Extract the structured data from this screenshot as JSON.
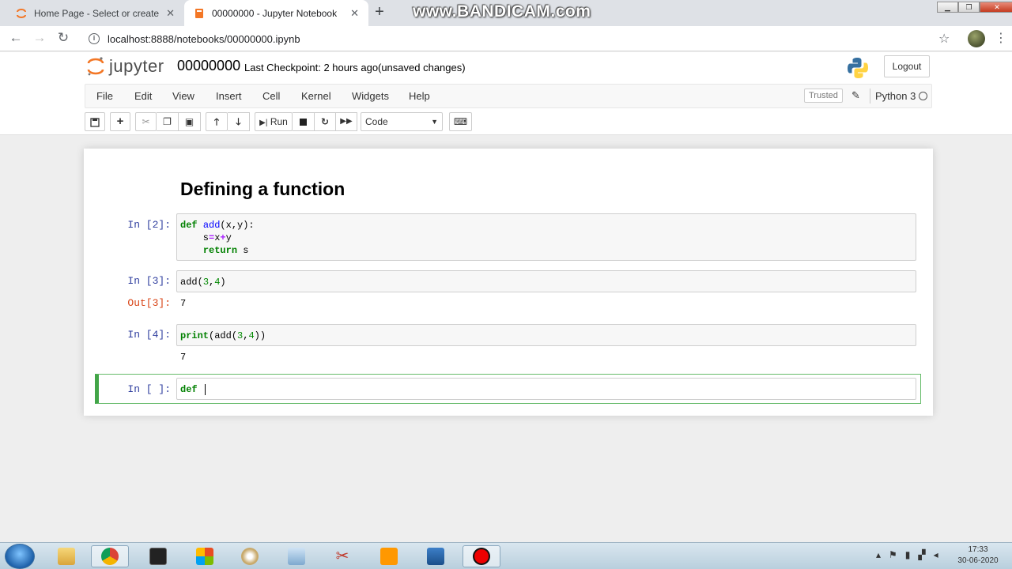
{
  "browser": {
    "tabs": [
      {
        "title": "Home Page - Select or create a n",
        "active": false
      },
      {
        "title": "00000000 - Jupyter Notebook",
        "active": true
      }
    ],
    "watermark": "www.BANDICAM.com",
    "url": "localhost:8888/notebooks/00000000.ipynb"
  },
  "header": {
    "logo_text": "jupyter",
    "notebook_name": "00000000",
    "checkpoint": "Last Checkpoint: 2 hours ago",
    "status": "(unsaved changes)",
    "logout_label": "Logout"
  },
  "menubar": {
    "items": [
      "File",
      "Edit",
      "View",
      "Insert",
      "Cell",
      "Kernel",
      "Widgets",
      "Help"
    ],
    "trusted_label": "Trusted",
    "kernel_name": "Python 3"
  },
  "toolbar": {
    "run_label": "Run",
    "cell_type": "Code"
  },
  "notebook": {
    "heading": "Defining a function",
    "cells": [
      {
        "prompt": "In [2]:",
        "code_lines": [
          "def add(x,y):",
          "    s=x+y",
          "    return s"
        ]
      },
      {
        "prompt": "In [3]:",
        "code_lines": [
          "add(3,4)"
        ],
        "out_prompt": "Out[3]:",
        "output": "7"
      },
      {
        "prompt": "In [4]:",
        "code_lines": [
          "print(add(3,4))"
        ],
        "output": "7"
      },
      {
        "prompt": "In [ ]:",
        "code_lines": [
          "def "
        ]
      }
    ]
  },
  "taskbar": {
    "clock_time": "17:33",
    "clock_date": "30-06-2020"
  },
  "colors": {
    "prompt_in": "#303f9f",
    "prompt_out": "#d84315",
    "selected_cell_border": "#42a548",
    "keyword": "#008000"
  }
}
